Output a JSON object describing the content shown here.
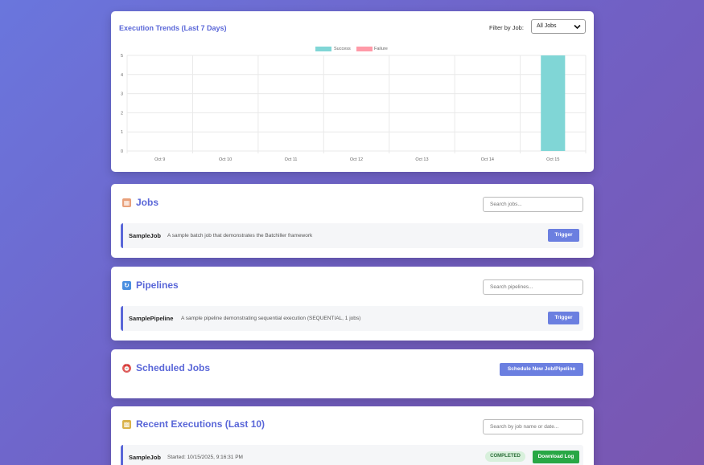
{
  "chart_card": {
    "title": "Execution Trends (Last 7 Days)",
    "filter_label": "Filter by Job:",
    "filter_value": "All Jobs"
  },
  "chart_data": {
    "type": "bar",
    "categories": [
      "Oct 9",
      "Oct 10",
      "Oct 11",
      "Oct 12",
      "Oct 13",
      "Oct 14",
      "Oct 15"
    ],
    "series": [
      {
        "name": "Success",
        "values": [
          0,
          0,
          0,
          0,
          0,
          0,
          5
        ],
        "color": "#80d6d6"
      },
      {
        "name": "Failure",
        "values": [
          0,
          0,
          0,
          0,
          0,
          0,
          0
        ],
        "color": "#ff9aa8"
      }
    ],
    "stacked": true,
    "ylim": [
      0,
      5
    ],
    "yticks": [
      "0",
      "1",
      "2",
      "3",
      "4",
      "5"
    ],
    "grid": true,
    "legend": "top-center"
  },
  "jobs": {
    "title": "Jobs",
    "icon": "clipboard-icon",
    "search_placeholder": "Search jobs...",
    "items": [
      {
        "name": "SampleJob",
        "description": "A sample batch job that demonstrates the Batchiller framework",
        "action": "Trigger"
      }
    ]
  },
  "pipelines": {
    "title": "Pipelines",
    "icon": "sync-icon",
    "search_placeholder": "Search pipelines...",
    "items": [
      {
        "name": "SamplePipeline",
        "description": "A sample pipeline demonstrating sequential execution (SEQUENTIAL, 1 jobs)",
        "action": "Trigger"
      }
    ]
  },
  "scheduled": {
    "title": "Scheduled Jobs",
    "icon": "alarm-clock-icon",
    "button": "Schedule New Job/Pipeline"
  },
  "recent": {
    "title": "Recent Executions (Last 10)",
    "icon": "bar-chart-icon",
    "search_placeholder": "Search by job name or date...",
    "items": [
      {
        "name": "SampleJob",
        "started": "Started: 10/15/2025, 9:16:31 PM",
        "status": "COMPLETED",
        "action": "Download Log"
      }
    ]
  },
  "colors": {
    "accent": "#5a67d8",
    "success": "#80d6d6",
    "failure": "#ff9aa8",
    "button_primary": "#6b7fe0",
    "button_green": "#28a745"
  }
}
